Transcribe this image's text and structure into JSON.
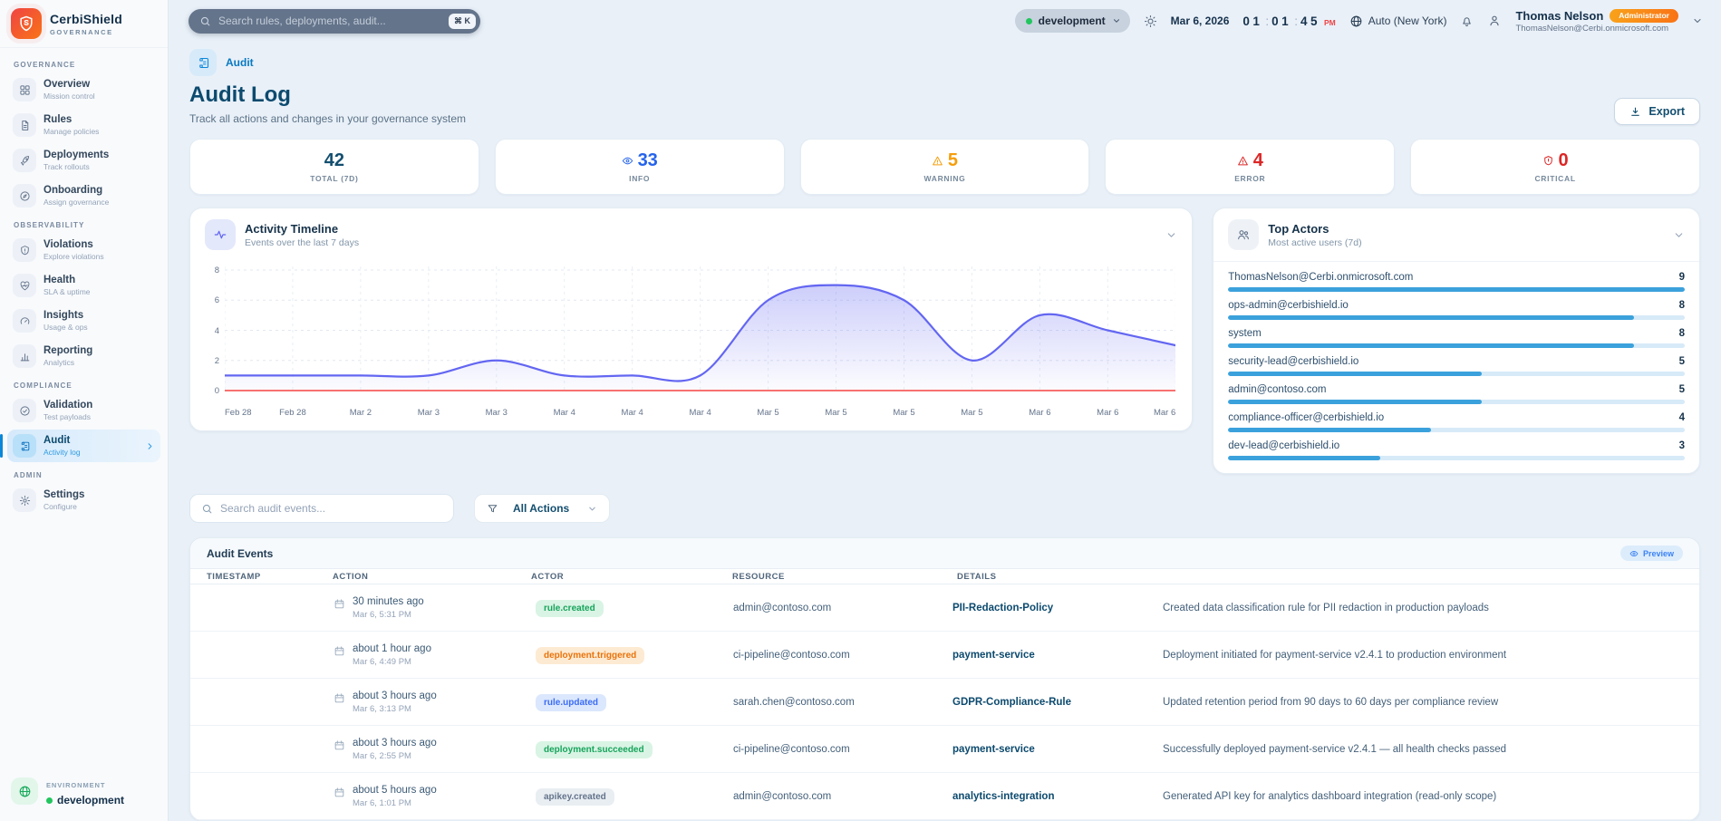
{
  "brand": {
    "name": "CerbiShield",
    "tagline": "GOVERNANCE"
  },
  "topbar": {
    "search_placeholder": "Search rules, deployments, audit...",
    "shortcut": "⌘ K",
    "env_pill": "development",
    "date": "Mar 6, 2026",
    "time": {
      "h": "01",
      "m": "01",
      "s": "45",
      "meridiem": "PM"
    },
    "timezone": "Auto (New York)",
    "user": {
      "name": "Thomas Nelson",
      "role": "Administrator",
      "email": "ThomasNelson@Cerbi.onmicrosoft.com"
    }
  },
  "sidebar": {
    "sections": [
      {
        "label": "GOVERNANCE",
        "items": [
          {
            "title": "Overview",
            "subtitle": "Mission control"
          },
          {
            "title": "Rules",
            "subtitle": "Manage policies"
          },
          {
            "title": "Deployments",
            "subtitle": "Track rollouts"
          },
          {
            "title": "Onboarding",
            "subtitle": "Assign governance"
          }
        ]
      },
      {
        "label": "OBSERVABILITY",
        "items": [
          {
            "title": "Violations",
            "subtitle": "Explore violations"
          },
          {
            "title": "Health",
            "subtitle": "SLA & uptime"
          },
          {
            "title": "Insights",
            "subtitle": "Usage & ops"
          },
          {
            "title": "Reporting",
            "subtitle": "Analytics"
          }
        ]
      },
      {
        "label": "COMPLIANCE",
        "items": [
          {
            "title": "Validation",
            "subtitle": "Test payloads"
          },
          {
            "title": "Audit",
            "subtitle": "Activity log",
            "active": true
          }
        ]
      },
      {
        "label": "ADMIN",
        "items": [
          {
            "title": "Settings",
            "subtitle": "Configure"
          }
        ]
      }
    ],
    "footer": {
      "label": "ENVIRONMENT",
      "value": "development"
    }
  },
  "page": {
    "breadcrumb": "Audit",
    "title": "Audit Log",
    "subtitle": "Track all actions and changes in your governance system",
    "export_label": "Export"
  },
  "stats": [
    {
      "value": "42",
      "label": "TOTAL (7D)",
      "icon": "none",
      "color": "#134e6f"
    },
    {
      "value": "33",
      "label": "INFO",
      "icon": "eye-icon",
      "color": "#2563eb"
    },
    {
      "value": "5",
      "label": "WARNING",
      "icon": "warning-triangle-icon",
      "color": "#f59e0b"
    },
    {
      "value": "4",
      "label": "ERROR",
      "icon": "warning-triangle-icon",
      "color": "#dc2626"
    },
    {
      "value": "0",
      "label": "CRITICAL",
      "icon": "shield-icon",
      "color": "#dc2626"
    }
  ],
  "chart_data": {
    "type": "area",
    "title": "Activity Timeline",
    "subtitle": "Events over the last 7 days",
    "categories": [
      "Feb 28",
      "Feb 28",
      "Mar 2",
      "Mar 3",
      "Mar 3",
      "Mar 4",
      "Mar 4",
      "Mar 4",
      "Mar 5",
      "Mar 5",
      "Mar 5",
      "Mar 5",
      "Mar 6",
      "Mar 6",
      "Mar 6"
    ],
    "values": [
      1,
      1,
      1,
      1,
      2,
      1,
      1,
      1,
      6,
      7,
      6,
      2,
      5,
      4,
      3
    ],
    "ylim": [
      0,
      8
    ],
    "yticks": [
      0,
      2,
      4,
      6,
      8
    ],
    "grid": true,
    "legend": false,
    "line_color": "#6366f1",
    "area_color": "#6366f1",
    "baseline_color": "#f87171"
  },
  "top_actors": {
    "title": "Top Actors",
    "subtitle": "Most active users (7d)",
    "max": 9,
    "bar_color": "#3ba1dc",
    "actors": [
      {
        "name": "ThomasNelson@Cerbi.onmicrosoft.com",
        "value": 9
      },
      {
        "name": "ops-admin@cerbishield.io",
        "value": 8
      },
      {
        "name": "system",
        "value": 8
      },
      {
        "name": "security-lead@cerbishield.io",
        "value": 5
      },
      {
        "name": "admin@contoso.com",
        "value": 5
      },
      {
        "name": "compliance-officer@cerbishield.io",
        "value": 4
      },
      {
        "name": "dev-lead@cerbishield.io",
        "value": 3
      }
    ]
  },
  "filters": {
    "search_placeholder": "Search audit events...",
    "action_filter": "All Actions"
  },
  "table": {
    "title": "Audit Events",
    "preview_label": "Preview",
    "columns": [
      "TIMESTAMP",
      "ACTION",
      "ACTOR",
      "RESOURCE",
      "DETAILS"
    ],
    "rows": [
      {
        "time_ago": "30 minutes ago",
        "timestamp": "Mar 6, 5:31 PM",
        "action": "rule.created",
        "variant": "green",
        "actor": "admin@contoso.com",
        "resource": "PII-Redaction-Policy",
        "details": "Created data classification rule for PII redaction in production payloads"
      },
      {
        "time_ago": "about 1 hour ago",
        "timestamp": "Mar 6, 4:49 PM",
        "action": "deployment.triggered",
        "variant": "orange",
        "actor": "ci-pipeline@contoso.com",
        "resource": "payment-service",
        "details": "Deployment initiated for payment-service v2.4.1 to production environment"
      },
      {
        "time_ago": "about 3 hours ago",
        "timestamp": "Mar 6, 3:13 PM",
        "action": "rule.updated",
        "variant": "blue",
        "actor": "sarah.chen@contoso.com",
        "resource": "GDPR-Compliance-Rule",
        "details": "Updated retention period from 90 days to 60 days per compliance review"
      },
      {
        "time_ago": "about 3 hours ago",
        "timestamp": "Mar 6, 2:55 PM",
        "action": "deployment.succeeded",
        "variant": "green",
        "actor": "ci-pipeline@contoso.com",
        "resource": "payment-service",
        "details": "Successfully deployed payment-service v2.4.1 — all health checks passed"
      },
      {
        "time_ago": "about 5 hours ago",
        "timestamp": "Mar 6, 1:01 PM",
        "action": "apikey.created",
        "variant": "gray",
        "actor": "admin@contoso.com",
        "resource": "analytics-integration",
        "details": "Generated API key for analytics dashboard integration (read-only scope)"
      }
    ]
  }
}
